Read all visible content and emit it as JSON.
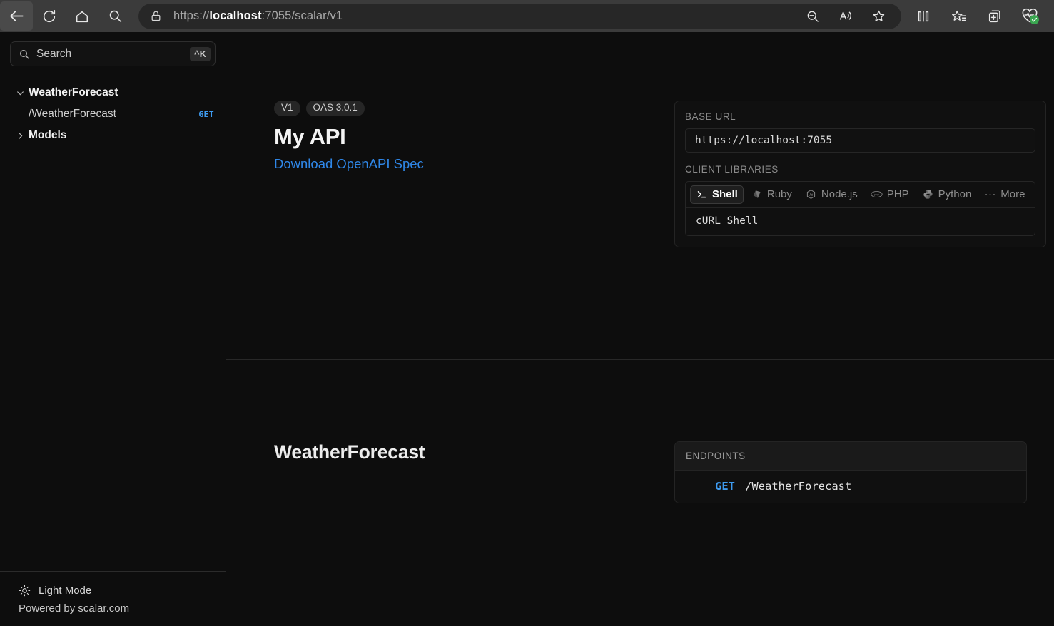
{
  "browser": {
    "back_title": "Back",
    "refresh_title": "Refresh",
    "home_title": "Home",
    "search_title": "Search",
    "url_scheme": "https://",
    "url_host": "localhost",
    "url_rest": ":7055/scalar/v1",
    "url_full": "https://localhost:7055/scalar/v1",
    "actions": [
      {
        "name": "zoom-out-icon",
        "title": "Zoom out"
      },
      {
        "name": "read-aloud-icon",
        "title": "Read aloud"
      },
      {
        "name": "favorite-star-icon",
        "title": "Add this page to favorites"
      }
    ],
    "right_actions": [
      {
        "name": "split-screen-icon",
        "title": "Split screen"
      },
      {
        "name": "favorites-list-icon",
        "title": "Favorites"
      },
      {
        "name": "collections-icon",
        "title": "Collections"
      },
      {
        "name": "browser-essentials-icon",
        "title": "Browser essentials"
      }
    ]
  },
  "sidebar": {
    "search": {
      "placeholder": "Search",
      "shortcut": "^K"
    },
    "tree": [
      {
        "label": "WeatherForecast",
        "type": "group",
        "expanded": true
      },
      {
        "label": "/WeatherForecast",
        "type": "child",
        "method": "GET"
      },
      {
        "label": "Models",
        "type": "group",
        "expanded": false
      }
    ],
    "footer": {
      "mode_label": "Light Mode",
      "powered": "Powered by scalar.com"
    }
  },
  "intro": {
    "badges": [
      "V1",
      "OAS 3.0.1"
    ],
    "title": "My API",
    "spec_link": "Download OpenAPI Spec",
    "base_url_label": "BASE URL",
    "base_url_value": "https://localhost:7055",
    "client_libraries_label": "CLIENT LIBRARIES",
    "languages": [
      {
        "label": "Shell",
        "icon": "shell-prompt-icon",
        "active": true
      },
      {
        "label": "Ruby",
        "icon": "ruby-gem-icon",
        "active": false
      },
      {
        "label": "Node.js",
        "icon": "nodejs-hexagon-icon",
        "active": false
      },
      {
        "label": "PHP",
        "icon": "php-elephant-icon",
        "active": false
      },
      {
        "label": "Python",
        "icon": "python-snakes-icon",
        "active": false
      },
      {
        "label": "More",
        "icon": "ellipsis-icon",
        "active": false
      }
    ],
    "snippet": "cURL Shell"
  },
  "tag_section": {
    "title": "WeatherForecast",
    "endpoints_label": "ENDPOINTS",
    "endpoints": [
      {
        "method": "GET",
        "path": "/WeatherForecast"
      }
    ]
  },
  "colors": {
    "accent_blue": "#3e9bf0",
    "link_blue": "#2f87e8",
    "page_bg": "#0d0d0d",
    "chrome_bg": "#3b3b3b",
    "border": "#282828",
    "health_green": "#3aa650"
  }
}
